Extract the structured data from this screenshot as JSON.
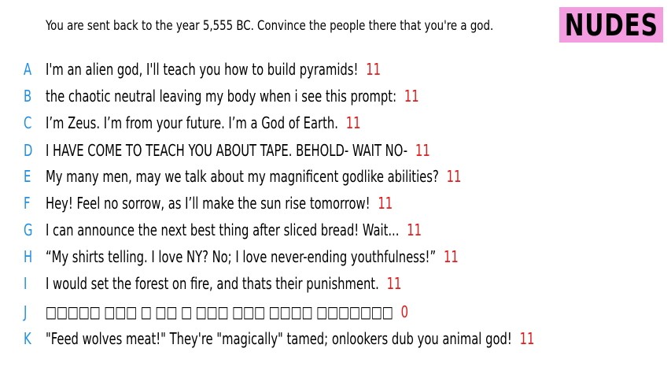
{
  "prompt": "You are sent back to the year 5,555 BC. Convince the people there that you're a god.",
  "badge": {
    "label": "NUDES",
    "color": "#f39ce0"
  },
  "colors": {
    "letter": "#1f8fe6",
    "score": "#e31b1b"
  },
  "answers": [
    {
      "letter": "A",
      "text": "I'm an alien god, I'll teach you how to build pyramids!",
      "score": "11"
    },
    {
      "letter": "B",
      "text": "the chaotic neutral leaving my body when i see this prompt:",
      "score": "11"
    },
    {
      "letter": "C",
      "text": "I’m Zeus. I’m from your future. I’m a God of Earth.",
      "score": "11"
    },
    {
      "letter": "D",
      "text": "I HAVE COME TO TEACH YOU ABOUT TAPE. BEHOLD- WAIT NO-",
      "score": "11"
    },
    {
      "letter": "E",
      "text": "My many men, may we talk about my magnificent godlike abilities?",
      "score": "11"
    },
    {
      "letter": "F",
      "text": "Hey! Feel no sorrow, as I’ll make the sun rise tomorrow!",
      "score": "11"
    },
    {
      "letter": "G",
      "text": "I can announce the next best thing after sliced bread! Wait...",
      "score": "11"
    },
    {
      "letter": "H",
      "text": "“My shirts telling. I love NY? No; I love never-ending youthfulness!”",
      "score": "11"
    },
    {
      "letter": "I",
      "text": "I would set the forest on fire, and thats their punishment.",
      "score": "11"
    },
    {
      "letter": "J",
      "text": "□□□□□ □□□ □ □□ □ □□□ □□□ □□□□ □□□□□□□",
      "score": "0"
    },
    {
      "letter": "K",
      "text": "\"Feed wolves meat!\" They're \"magically\" tamed; onlookers dub you animal god!",
      "score": "11"
    }
  ]
}
